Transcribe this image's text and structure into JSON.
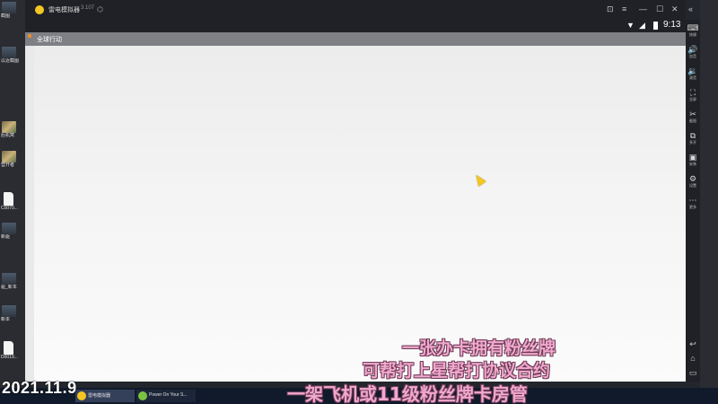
{
  "emulator": {
    "title": "雷电模拟器",
    "version": "3.107",
    "window_controls": [
      "⊡",
      "≡",
      "—",
      "☐",
      "✕",
      "«"
    ]
  },
  "status_bar": {
    "time": "9:13"
  },
  "app": {
    "title": "全球行动"
  },
  "sidebar": {
    "tools": [
      {
        "icon": "keyboard-icon",
        "glyph": "⌨",
        "label": "按键"
      },
      {
        "icon": "volume-up-icon",
        "glyph": "🔊",
        "label": "加音"
      },
      {
        "icon": "volume-down-icon",
        "glyph": "🔉",
        "label": "减音"
      },
      {
        "icon": "fullscreen-icon",
        "glyph": "⛶",
        "label": "全屏"
      },
      {
        "icon": "scissors-icon",
        "glyph": "✂",
        "label": "截图"
      },
      {
        "icon": "multi-open-icon",
        "glyph": "⧉",
        "label": "多开"
      },
      {
        "icon": "install-icon",
        "glyph": "▣",
        "label": "安装"
      },
      {
        "icon": "settings-icon",
        "glyph": "⚙",
        "label": "设置"
      },
      {
        "icon": "more-icon",
        "glyph": "⋯",
        "label": "更多"
      }
    ],
    "nav": [
      "↩",
      "⌂",
      "▭"
    ]
  },
  "desktop": {
    "icons": [
      {
        "label": "截图"
      },
      {
        "label": "以近截图"
      },
      {
        "label": "后机窝"
      },
      {
        "label": "营开者"
      },
      {
        "label": "C0070..."
      },
      {
        "label": "新驱"
      },
      {
        "label": "驱_新本"
      },
      {
        "label": "新本"
      },
      {
        "label": "D0019..."
      }
    ]
  },
  "taskbar": {
    "date_overlay": "2021.11.9",
    "items": [
      {
        "label": "雷电模拟器"
      },
      {
        "label": "Power On Your S..."
      }
    ]
  },
  "overlay_caption": {
    "line1": "一张办卡拥有粉丝牌",
    "line2": "可帮打上星帮打协议合约",
    "line3": "一架飞机或11级粉丝牌卡房管"
  }
}
